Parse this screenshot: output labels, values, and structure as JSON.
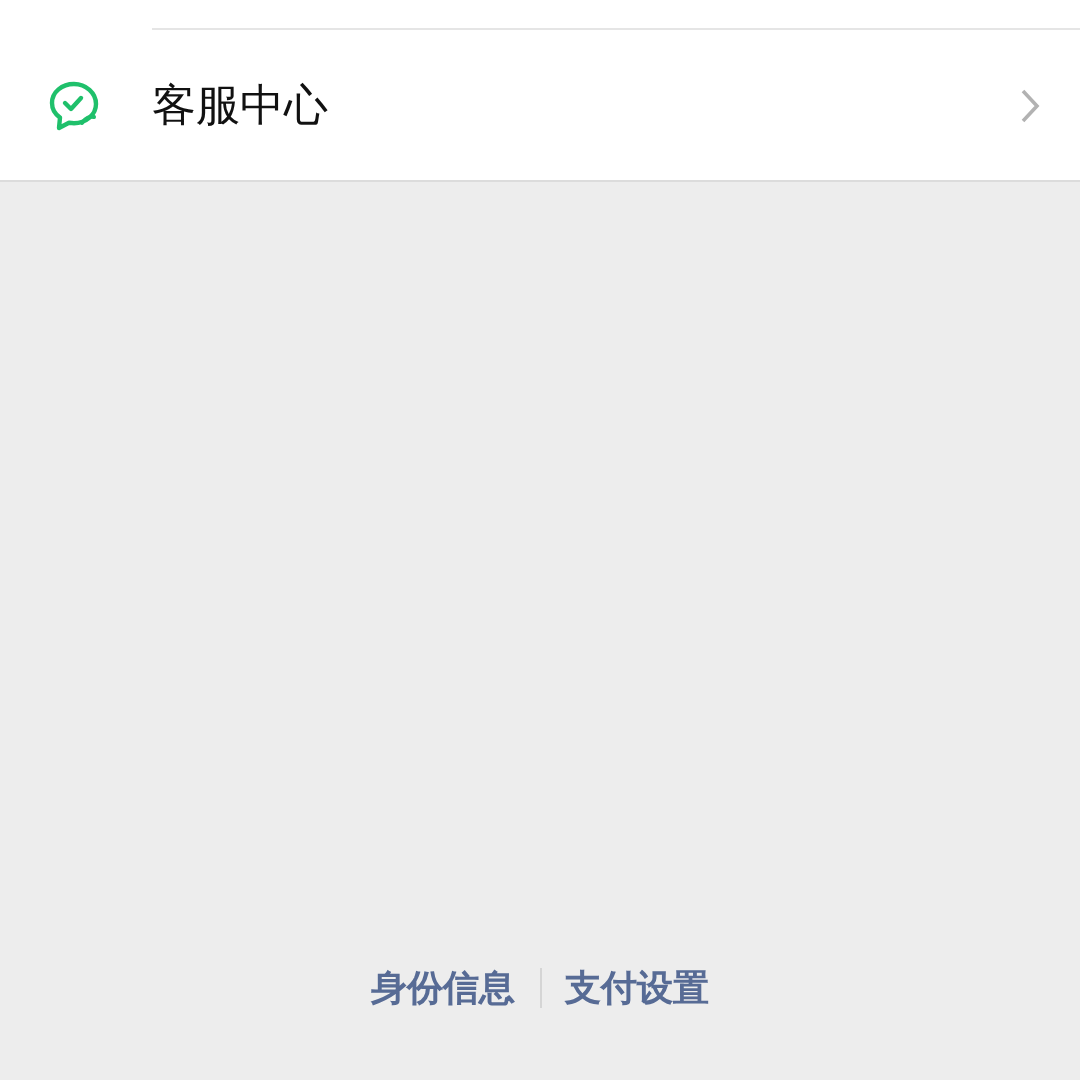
{
  "menu_items": [
    {
      "label": "客服中心"
    }
  ],
  "footer_links": [
    "身份信息",
    "支付设置"
  ]
}
